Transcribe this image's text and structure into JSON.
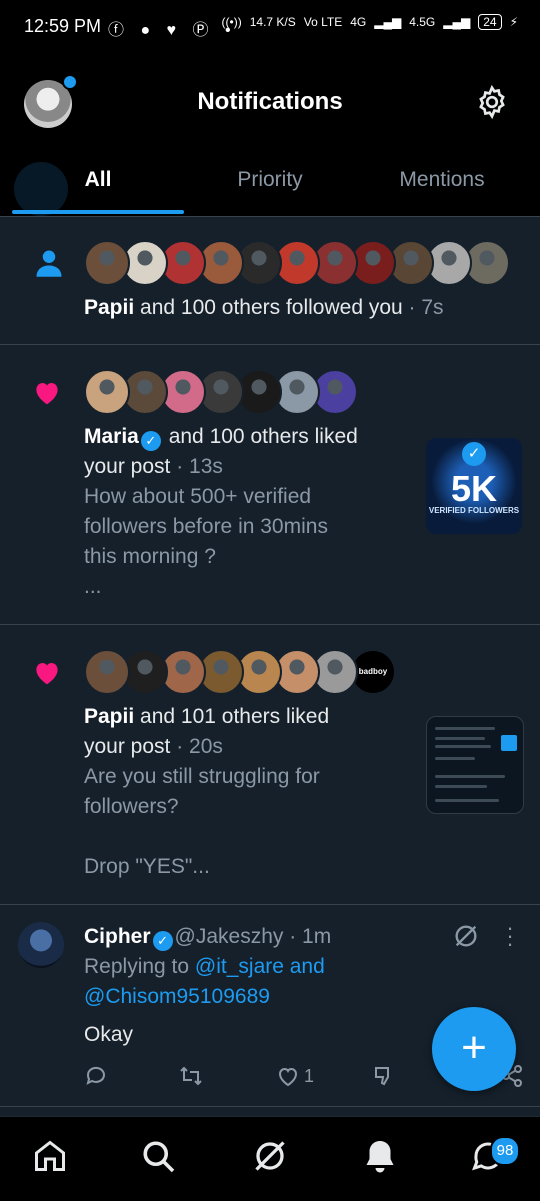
{
  "status_bar": {
    "time": "12:59 PM",
    "left_icons": "ⓕ ● ♥ Ⓟ •",
    "network_speed": "14.7 K/S",
    "volte": "Vo LTE",
    "net1": "4G",
    "net2": "4.5G",
    "battery": "24"
  },
  "header": {
    "title": "Notifications",
    "settings_icon": "gear-icon"
  },
  "tabs": [
    {
      "label": "All",
      "active": true
    },
    {
      "label": "Priority",
      "active": false
    },
    {
      "label": "Mentions",
      "active": false
    }
  ],
  "notifications": [
    {
      "type": "follow",
      "icon": "person-icon",
      "actor": "Papii",
      "text": " and 100 others followed you",
      "time": " · 7s",
      "avatar_colors": [
        "#6b4f3a",
        "#d9d2c7",
        "#b13232",
        "#9a5a3c",
        "#2a2a2a",
        "#c0392b",
        "#8a3030",
        "#7a1d1d",
        "#5a4634",
        "#a8a8a8",
        "#6d6a60"
      ]
    },
    {
      "type": "like",
      "icon": "heart-icon",
      "actor": "Maria",
      "verified": true,
      "text_line1": " and 100 others liked",
      "text_line2": "your post",
      "time": " · 13s",
      "preview": [
        "How about 500+ verified",
        "followers before in 30mins",
        "this morning ?",
        "..."
      ],
      "thumb": {
        "big": "5K",
        "caption": "VERIFIED FOLLOWERS"
      },
      "avatar_colors": [
        "#c9a27e",
        "#5b4a3a",
        "#d26a8a",
        "#3a3a3a",
        "#1a1a1a",
        "#8b98a5",
        "#4b3fa0"
      ]
    },
    {
      "type": "like",
      "icon": "heart-icon",
      "actor": "Papii",
      "text_line1": " and 101 others liked",
      "text_line2": "your post",
      "time": " · 20s",
      "preview": [
        "Are you still struggling for",
        "followers?",
        "",
        "Drop \"YES\"..."
      ],
      "last_avatar_label": "badboy",
      "avatar_colors": [
        "#6b4f3a",
        "#1f1f1f",
        "#a0664a",
        "#7a5a2e",
        "#b8864e",
        "#c58f6a",
        "#9a9a9a",
        "#000000"
      ]
    }
  ],
  "reply_tweet": {
    "name": "Cipher",
    "verified": true,
    "handle": "@Jakeszhy",
    "time": " · 1m",
    "replying_prefix": "Replying to ",
    "replying_users": "@it_sjare and",
    "replying_users2": "@Chisom95109689",
    "body": "Okay",
    "likes": "1"
  },
  "fab": {
    "label": "+"
  },
  "bottom_nav": {
    "items": [
      "home-icon",
      "search-icon",
      "grok-icon",
      "notifications-icon",
      "messages-icon"
    ],
    "messages_badge": "98"
  }
}
